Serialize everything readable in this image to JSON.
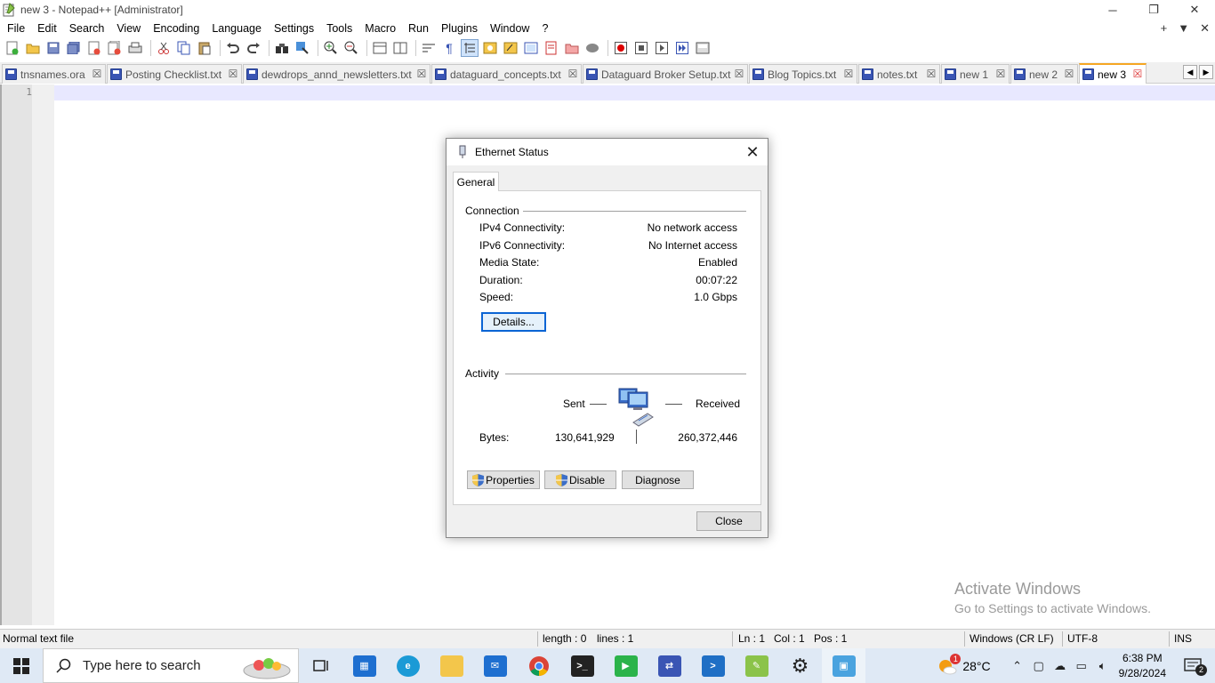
{
  "window": {
    "title": "new 3 - Notepad++ [Administrator]"
  },
  "menu": [
    "File",
    "Edit",
    "Search",
    "View",
    "Encoding",
    "Language",
    "Settings",
    "Tools",
    "Macro",
    "Run",
    "Plugins",
    "Window",
    "?"
  ],
  "menu_right": {
    "plus": "+",
    "dropdown": "▼",
    "close": "✕"
  },
  "tabs": [
    {
      "label": "tnsnames.ora"
    },
    {
      "label": "Posting Checklist.txt"
    },
    {
      "label": "dewdrops_annd_newsletters.txt"
    },
    {
      "label": "dataguard_concepts.txt"
    },
    {
      "label": "Dataguard Broker Setup.txt"
    },
    {
      "label": "Blog Topics.txt"
    },
    {
      "label": "notes.txt"
    },
    {
      "label": "new 1"
    },
    {
      "label": "new 2"
    },
    {
      "label": "new 3"
    }
  ],
  "editor": {
    "line_number": "1"
  },
  "watermark": {
    "line1": "Activate Windows",
    "line2": "Go to Settings to activate Windows."
  },
  "statusbar": {
    "file_type": "Normal text file",
    "length": "length : 0",
    "lines": "lines : 1",
    "ln": "Ln : 1",
    "col": "Col : 1",
    "pos": "Pos : 1",
    "eol": "Windows (CR LF)",
    "encoding": "UTF-8",
    "mode": "INS"
  },
  "dialog": {
    "title": "Ethernet Status",
    "tab": "General",
    "connection_label": "Connection",
    "rows": [
      {
        "label": "IPv4 Connectivity:",
        "value": "No network access"
      },
      {
        "label": "IPv6 Connectivity:",
        "value": "No Internet access"
      },
      {
        "label": "Media State:",
        "value": "Enabled"
      },
      {
        "label": "Duration:",
        "value": "00:07:22"
      },
      {
        "label": "Speed:",
        "value": "1.0 Gbps"
      }
    ],
    "details_button": "Details...",
    "activity_label": "Activity",
    "sent_label": "Sent",
    "received_label": "Received",
    "bytes_label": "Bytes:",
    "bytes_sent": "130,641,929",
    "bytes_received": "260,372,446",
    "properties_button": "Properties",
    "disable_button": "Disable",
    "diagnose_button": "Diagnose",
    "close_button": "Close"
  },
  "taskbar": {
    "search_placeholder": "Type here to search",
    "weather": "28°C",
    "weather_badge": "1",
    "time": "6:38 PM",
    "date": "9/28/2024",
    "notifications": "2"
  },
  "colors": {
    "accent": "#0a64d4",
    "active_tab_border": "#f5a623",
    "current_line": "#e8e8ff",
    "taskbar": "#dfe9f5"
  }
}
